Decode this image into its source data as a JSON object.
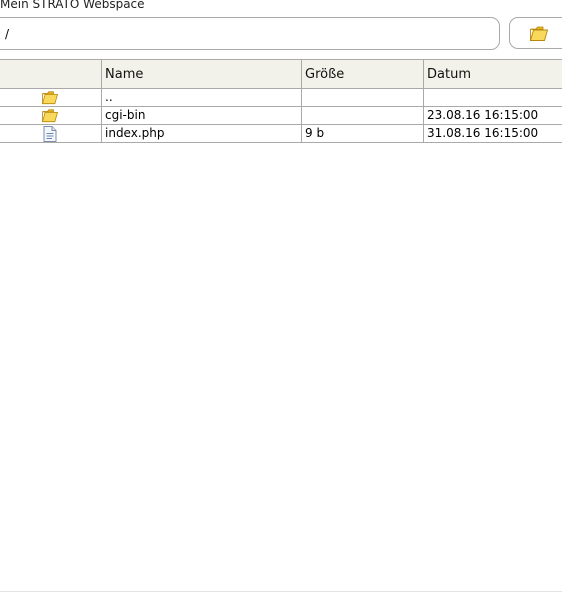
{
  "panel": {
    "title": "Mein STRATO Webspace"
  },
  "path": {
    "value": "/"
  },
  "table": {
    "headers": {
      "icon": "",
      "name": "Name",
      "size": "Größe",
      "date": "Datum"
    },
    "rows": [
      {
        "type": "folder",
        "icon": "folder-icon",
        "name": "..",
        "size": "",
        "date": ""
      },
      {
        "type": "folder",
        "icon": "folder-icon",
        "name": "cgi-bin",
        "size": "",
        "date": "23.08.16 16:15:00"
      },
      {
        "type": "file",
        "icon": "document-icon",
        "name": "index.php",
        "size": "9 b",
        "date": "31.08.16 16:15:00"
      }
    ]
  },
  "colors": {
    "header_bg": "#f2f2ea",
    "border": "#a9a9a9",
    "folder": "#f7d44a"
  }
}
